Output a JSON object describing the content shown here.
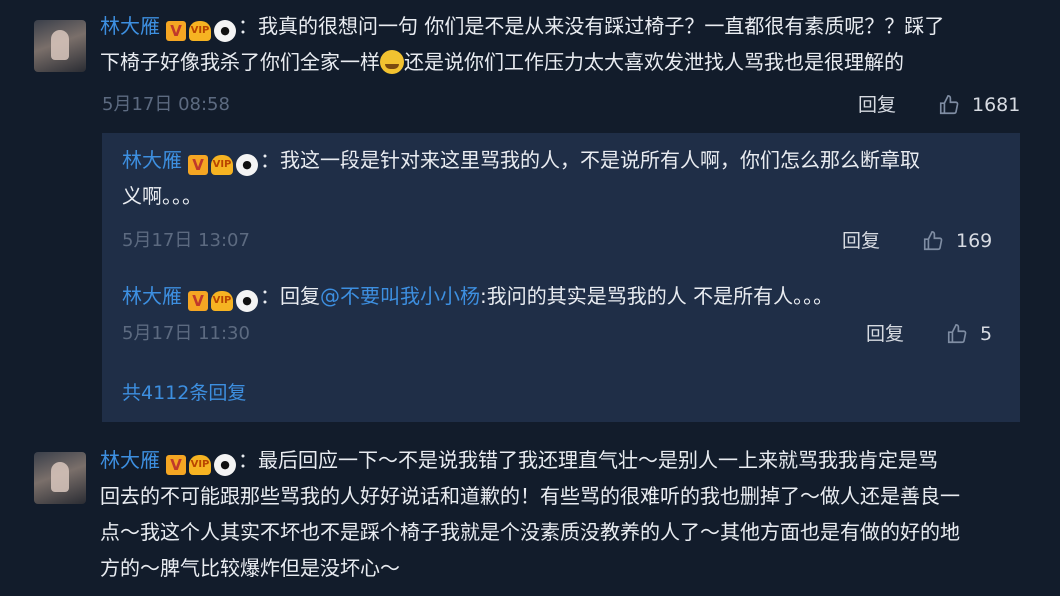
{
  "comments": [
    {
      "user": "林大雁",
      "line1": "：我真的很想问一句 你们是不是从来没有踩过椅子？一直都很有素质呢？？踩了",
      "line2a": "下椅子好像我杀了你们全家一样",
      "line2b": "还是说你们工作压力太大喜欢发泄找人骂我也是很理解的",
      "time": "5月17日 08:58",
      "reply": "回复",
      "likes": "1681"
    },
    {
      "user": "林大雁",
      "line1": "：最后回应一下～不是说我错了我还理直气壮～是别人一上来就骂我我肯定是骂",
      "line2": "回去的不可能跟那些骂我的人好好说话和道歉的！有些骂的很难听的我也删掉了～做人还是善良一",
      "line3": "点～我这个人其实不坏也不是踩个椅子我就是个没素质没教养的人了～其他方面也是有做的好的地",
      "line4": "方的～脾气比较爆炸但是没坏心～"
    }
  ],
  "replies": [
    {
      "user": "林大雁",
      "line1": "：我这一段是针对来这里骂我的人，不是说所有人啊，你们怎么那么断章取",
      "line2": "义啊。。。",
      "time": "5月17日 13:07",
      "reply": "回复",
      "likes": "169"
    },
    {
      "user": "林大雁",
      "prefix": "：回复",
      "mention": "@不要叫我小小杨",
      "text": ":我问的其实是骂我的人 不是所有人。。。",
      "time": "5月17日 11:30",
      "reply": "回复",
      "likes": "5"
    }
  ],
  "total_replies": "共4112条回复",
  "badges": {
    "v": "V",
    "vip": "VIP",
    "panda": "●"
  },
  "colors": {
    "name": "#3d8fe0",
    "background": "#121c2b",
    "reply_box": "#1f2e47"
  }
}
